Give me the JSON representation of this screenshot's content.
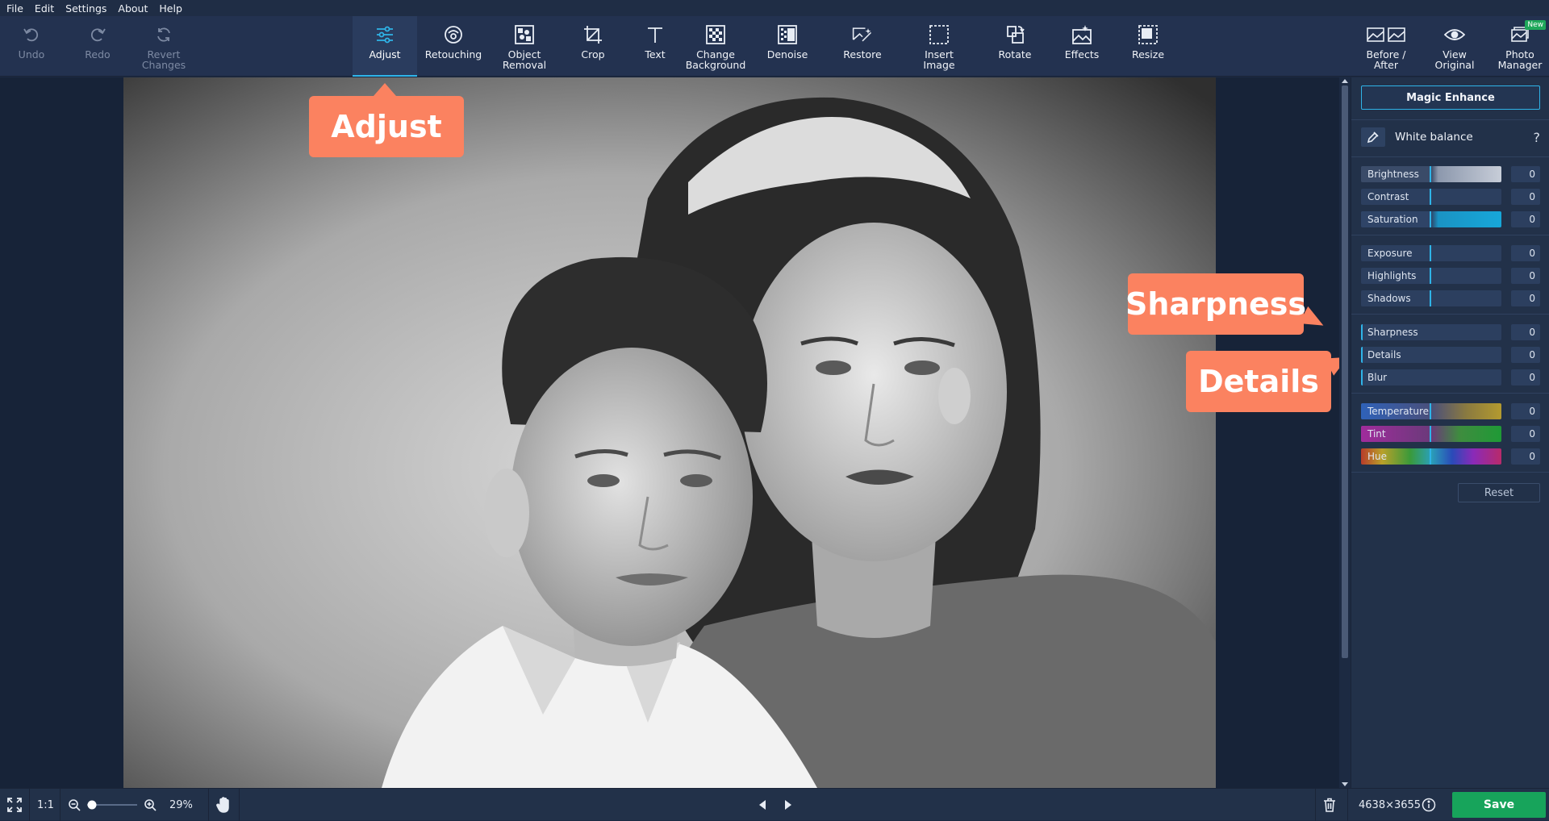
{
  "menu": [
    "File",
    "Edit",
    "Settings",
    "About",
    "Help"
  ],
  "toolbar": {
    "undo": "Undo",
    "redo": "Redo",
    "revert": [
      "Revert",
      "Changes"
    ],
    "tools": [
      {
        "key": "adjust",
        "label": [
          "Adjust"
        ],
        "active": true
      },
      {
        "key": "retouching",
        "label": [
          "Retouching"
        ]
      },
      {
        "key": "object-removal",
        "label": [
          "Object",
          "Removal"
        ]
      },
      {
        "key": "crop",
        "label": [
          "Crop"
        ]
      },
      {
        "key": "text",
        "label": [
          "Text"
        ]
      },
      {
        "key": "change-background",
        "label": [
          "Change",
          "Background"
        ]
      },
      {
        "key": "denoise",
        "label": [
          "Denoise"
        ]
      },
      {
        "key": "restore",
        "label": [
          "Restore"
        ]
      },
      {
        "key": "insert-image",
        "label": [
          "Insert",
          "Image"
        ]
      },
      {
        "key": "rotate",
        "label": [
          "Rotate"
        ]
      },
      {
        "key": "effects",
        "label": [
          "Effects"
        ]
      },
      {
        "key": "resize",
        "label": [
          "Resize"
        ]
      }
    ],
    "before_after": [
      "Before /",
      "After"
    ],
    "view_original": [
      "View",
      "Original"
    ],
    "photo_manager": [
      "Photo",
      "Manager"
    ],
    "new_badge": "New"
  },
  "callouts": {
    "adjust": "Adjust",
    "sharpness": "Sharpness",
    "details": "Details"
  },
  "panel": {
    "magic_enhance": "Magic Enhance",
    "white_balance": "White balance",
    "help": "?",
    "groups": [
      [
        {
          "label": "Brightness",
          "value": "0",
          "style": "gray"
        },
        {
          "label": "Contrast",
          "value": "0",
          "style": "plain"
        },
        {
          "label": "Saturation",
          "value": "0",
          "style": "cyan"
        }
      ],
      [
        {
          "label": "Exposure",
          "value": "0",
          "style": "plain"
        },
        {
          "label": "Highlights",
          "value": "0",
          "style": "plain"
        },
        {
          "label": "Shadows",
          "value": "0",
          "style": "plain"
        }
      ],
      [
        {
          "label": "Sharpness",
          "value": "0",
          "style": "zero"
        },
        {
          "label": "Details",
          "value": "0",
          "style": "zero"
        },
        {
          "label": "Blur",
          "value": "0",
          "style": "zero"
        }
      ],
      [
        {
          "label": "Temperature",
          "value": "0",
          "style": "temp"
        },
        {
          "label": "Tint",
          "value": "0",
          "style": "tint"
        },
        {
          "label": "Hue",
          "value": "0",
          "style": "hue"
        }
      ]
    ],
    "reset": "Reset"
  },
  "statusbar": {
    "ratio": "1:1",
    "zoom": "29%",
    "dimensions": "4638×3655",
    "save": "Save"
  },
  "colors": {
    "accent": "#2fb4e8",
    "callout": "#fb8260",
    "save": "#17a45b"
  }
}
